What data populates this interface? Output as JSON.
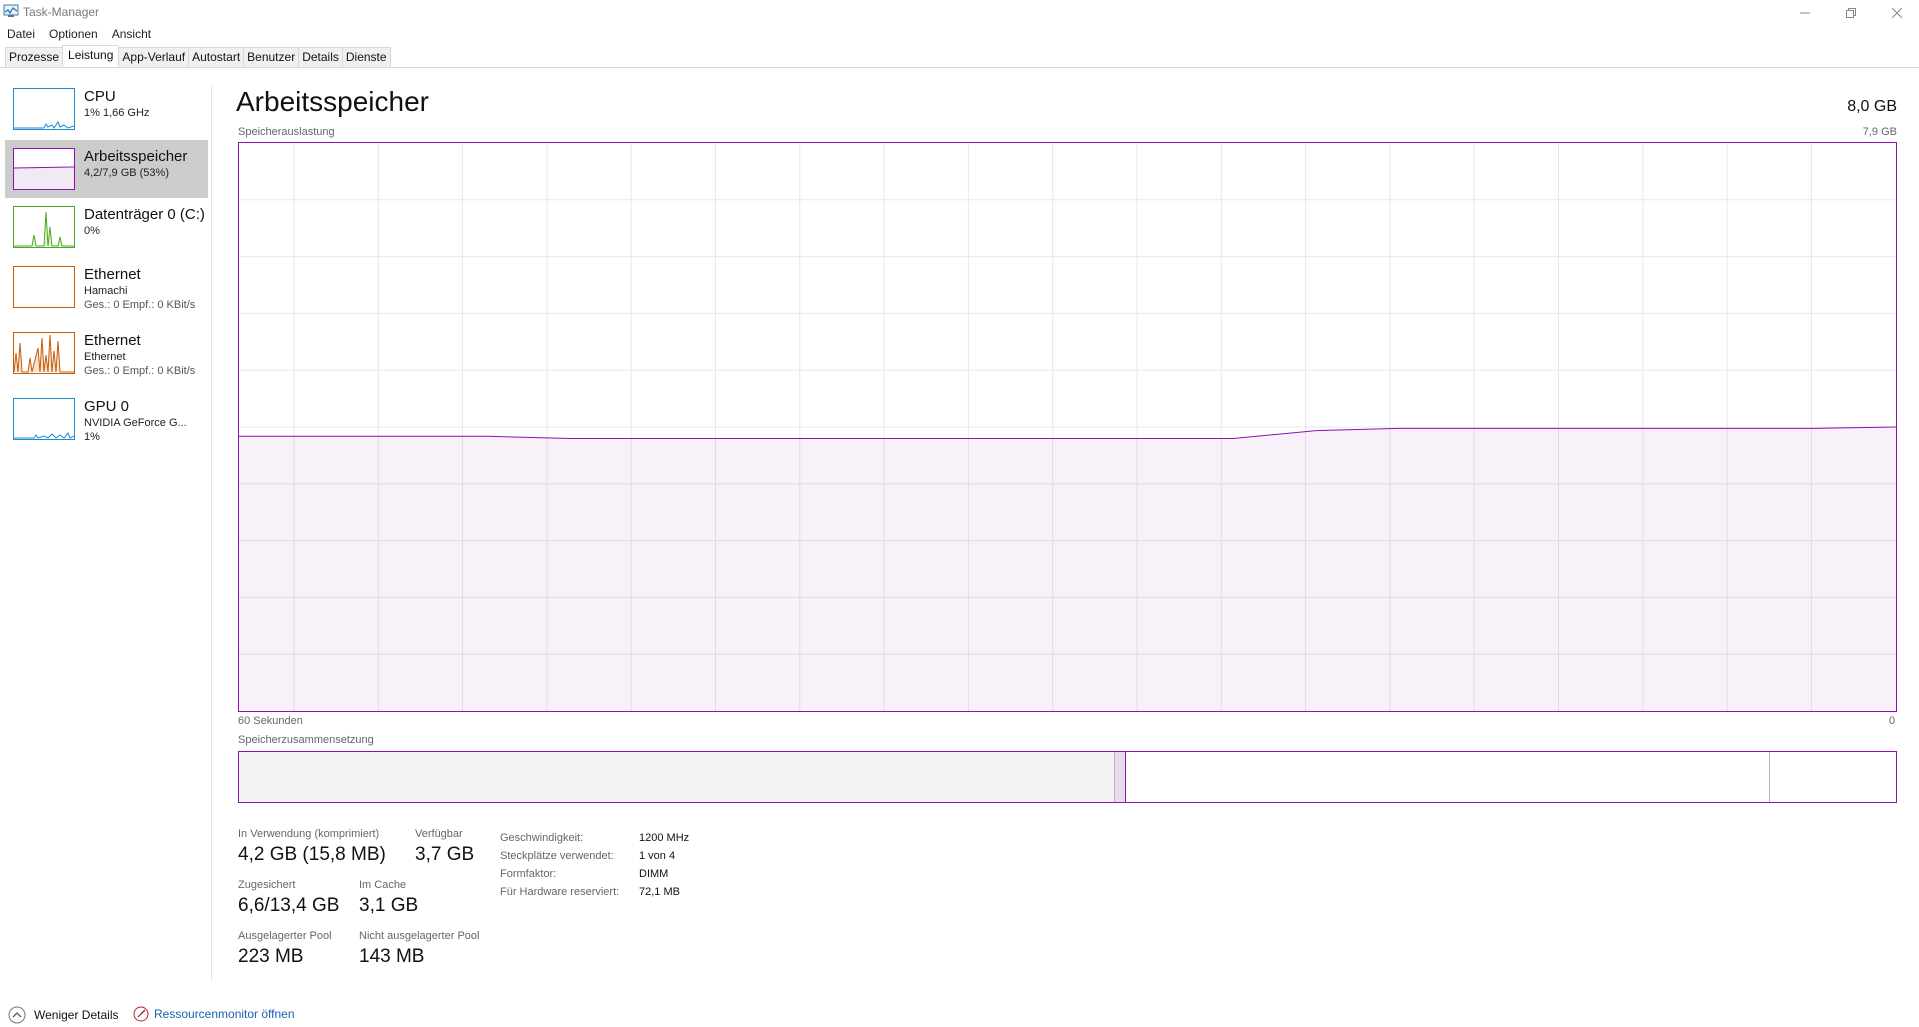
{
  "window": {
    "title": "Task-Manager"
  },
  "menu": [
    "Datei",
    "Optionen",
    "Ansicht"
  ],
  "tabs": [
    "Prozesse",
    "Leistung",
    "App-Verlauf",
    "Autostart",
    "Benutzer",
    "Details",
    "Dienste"
  ],
  "active_tab": "Leistung",
  "sidebar": {
    "items": [
      {
        "title": "CPU",
        "sub1": "1% 1,66 GHz",
        "sub2": "",
        "color": "#1d8ad4",
        "selected": false
      },
      {
        "title": "Arbeitsspeicher",
        "sub1": "4,2/7,9 GB (53%)",
        "sub2": "",
        "color": "#8b12ae",
        "selected": true
      },
      {
        "title": "Datenträger 0 (C:)",
        "sub1": "0%",
        "sub2": "",
        "color": "#4da81f",
        "selected": false
      },
      {
        "title": "Ethernet",
        "sub1": "Hamachi",
        "sub2": "Ges.: 0 Empf.: 0 KBit/s",
        "color": "#c85b08",
        "selected": false
      },
      {
        "title": "Ethernet",
        "sub1": "Ethernet",
        "sub2": "Ges.: 0 Empf.: 0 KBit/s",
        "color": "#c85b08",
        "selected": false
      },
      {
        "title": "GPU 0",
        "sub1": "NVIDIA GeForce G...",
        "sub2": "1%",
        "color": "#1d8ad4",
        "selected": false
      }
    ]
  },
  "main": {
    "title": "Arbeitsspeicher",
    "total": "8,0 GB",
    "usage_label": "Speicherauslastung",
    "usage_max": "7,9 GB",
    "time_left": "60 Sekunden",
    "time_right": "0",
    "composition_label": "Speicherzusammensetzung",
    "accent_color": "#8b12ae"
  },
  "chart_data": {
    "type": "area",
    "ylabel": "Speicherauslastung",
    "ylim": [
      0,
      7.9
    ],
    "x": [
      60,
      57,
      54,
      51,
      48,
      45,
      42,
      39,
      36,
      33,
      30,
      27,
      24,
      21,
      18,
      15,
      12,
      9,
      6,
      3,
      0
    ],
    "values": [
      3.82,
      3.82,
      3.82,
      3.82,
      3.79,
      3.79,
      3.79,
      3.79,
      3.79,
      3.79,
      3.79,
      3.79,
      3.79,
      3.9,
      3.93,
      3.93,
      3.93,
      3.93,
      3.93,
      3.93,
      3.95
    ],
    "grid": true
  },
  "stats": [
    {
      "label": "In Verwendung (komprimiert)",
      "value": "4,2 GB (15,8 MB)"
    },
    {
      "label": "Verfügbar",
      "value": "3,7 GB"
    },
    {
      "label": "Zugesichert",
      "value": "6,6/13,4 GB"
    },
    {
      "label": "Im Cache",
      "value": "3,1 GB"
    },
    {
      "label": "Ausgelagerter Pool",
      "value": "223 MB"
    },
    {
      "label": "Nicht ausgelagerter Pool",
      "value": "143 MB"
    }
  ],
  "details": {
    "labels": [
      "Geschwindigkeit:",
      "Steckplätze verwendet:",
      "Formfaktor:",
      "Für Hardware reserviert:"
    ],
    "values": [
      "1200 MHz",
      "1 von 4",
      "DIMM",
      "72,1 MB"
    ]
  },
  "footer": {
    "fewer_details": "Weniger Details",
    "resource_monitor": "Ressourcenmonitor öffnen"
  }
}
